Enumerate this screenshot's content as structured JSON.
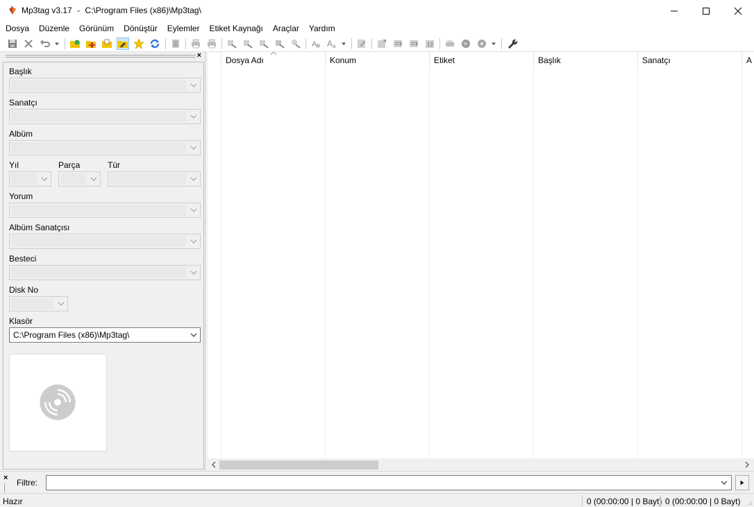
{
  "window": {
    "app_name": "Mp3tag v3.17",
    "separator": "-",
    "path": "C:\\Program Files (x86)\\Mp3tag\\"
  },
  "menu": [
    "Dosya",
    "Düzenle",
    "Görünüm",
    "Dönüştür",
    "Eylemler",
    "Etiket Kaynağı",
    "Araçlar",
    "Yardım"
  ],
  "tag_panel": {
    "title_label": "Başlık",
    "artist_label": "Sanatçı",
    "album_label": "Albüm",
    "year_label": "Yıl",
    "track_label": "Parça",
    "genre_label": "Tür",
    "comment_label": "Yorum",
    "album_artist_label": "Albüm Sanatçısı",
    "composer_label": "Besteci",
    "disc_label": "Disk No",
    "folder_label": "Klasör",
    "folder_value": "C:\\Program Files (x86)\\Mp3tag\\"
  },
  "file_list": {
    "columns": [
      "Dosya Adı",
      "Konum",
      "Etiket",
      "Başlık",
      "Sanatçı",
      "A"
    ]
  },
  "filter": {
    "label": "Filtre:",
    "value": ""
  },
  "status": {
    "ready": "Hazır",
    "selected": "0 (00:00:00 | 0 Bayt)",
    "total": "0 (00:00:00 | 0 Bayt)"
  },
  "colors": {
    "accent_blue": "#1e6fd9",
    "folder_yellow": "#f2c200",
    "icon_gray": "#8a8a8a"
  }
}
